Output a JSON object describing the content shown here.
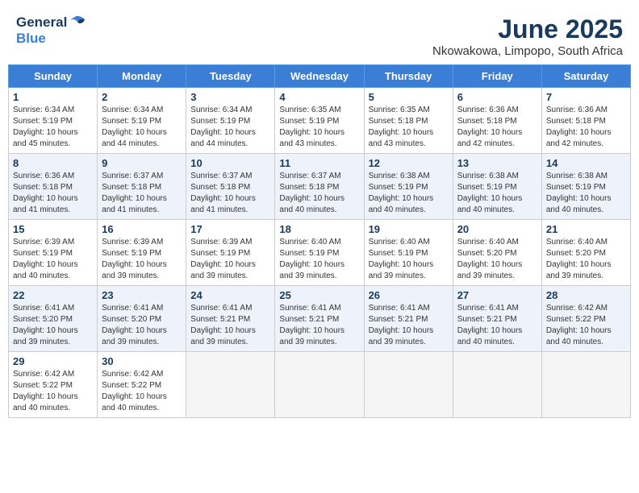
{
  "header": {
    "logo_general": "General",
    "logo_blue": "Blue",
    "month": "June 2025",
    "location": "Nkowakowa, Limpopo, South Africa"
  },
  "days_of_week": [
    "Sunday",
    "Monday",
    "Tuesday",
    "Wednesday",
    "Thursday",
    "Friday",
    "Saturday"
  ],
  "weeks": [
    [
      {
        "day": "1",
        "sunrise": "6:34 AM",
        "sunset": "5:19 PM",
        "daylight": "10 hours and 45 minutes."
      },
      {
        "day": "2",
        "sunrise": "6:34 AM",
        "sunset": "5:19 PM",
        "daylight": "10 hours and 44 minutes."
      },
      {
        "day": "3",
        "sunrise": "6:34 AM",
        "sunset": "5:19 PM",
        "daylight": "10 hours and 44 minutes."
      },
      {
        "day": "4",
        "sunrise": "6:35 AM",
        "sunset": "5:19 PM",
        "daylight": "10 hours and 43 minutes."
      },
      {
        "day": "5",
        "sunrise": "6:35 AM",
        "sunset": "5:18 PM",
        "daylight": "10 hours and 43 minutes."
      },
      {
        "day": "6",
        "sunrise": "6:36 AM",
        "sunset": "5:18 PM",
        "daylight": "10 hours and 42 minutes."
      },
      {
        "day": "7",
        "sunrise": "6:36 AM",
        "sunset": "5:18 PM",
        "daylight": "10 hours and 42 minutes."
      }
    ],
    [
      {
        "day": "8",
        "sunrise": "6:36 AM",
        "sunset": "5:18 PM",
        "daylight": "10 hours and 41 minutes."
      },
      {
        "day": "9",
        "sunrise": "6:37 AM",
        "sunset": "5:18 PM",
        "daylight": "10 hours and 41 minutes."
      },
      {
        "day": "10",
        "sunrise": "6:37 AM",
        "sunset": "5:18 PM",
        "daylight": "10 hours and 41 minutes."
      },
      {
        "day": "11",
        "sunrise": "6:37 AM",
        "sunset": "5:18 PM",
        "daylight": "10 hours and 40 minutes."
      },
      {
        "day": "12",
        "sunrise": "6:38 AM",
        "sunset": "5:19 PM",
        "daylight": "10 hours and 40 minutes."
      },
      {
        "day": "13",
        "sunrise": "6:38 AM",
        "sunset": "5:19 PM",
        "daylight": "10 hours and 40 minutes."
      },
      {
        "day": "14",
        "sunrise": "6:38 AM",
        "sunset": "5:19 PM",
        "daylight": "10 hours and 40 minutes."
      }
    ],
    [
      {
        "day": "15",
        "sunrise": "6:39 AM",
        "sunset": "5:19 PM",
        "daylight": "10 hours and 40 minutes."
      },
      {
        "day": "16",
        "sunrise": "6:39 AM",
        "sunset": "5:19 PM",
        "daylight": "10 hours and 39 minutes."
      },
      {
        "day": "17",
        "sunrise": "6:39 AM",
        "sunset": "5:19 PM",
        "daylight": "10 hours and 39 minutes."
      },
      {
        "day": "18",
        "sunrise": "6:40 AM",
        "sunset": "5:19 PM",
        "daylight": "10 hours and 39 minutes."
      },
      {
        "day": "19",
        "sunrise": "6:40 AM",
        "sunset": "5:19 PM",
        "daylight": "10 hours and 39 minutes."
      },
      {
        "day": "20",
        "sunrise": "6:40 AM",
        "sunset": "5:20 PM",
        "daylight": "10 hours and 39 minutes."
      },
      {
        "day": "21",
        "sunrise": "6:40 AM",
        "sunset": "5:20 PM",
        "daylight": "10 hours and 39 minutes."
      }
    ],
    [
      {
        "day": "22",
        "sunrise": "6:41 AM",
        "sunset": "5:20 PM",
        "daylight": "10 hours and 39 minutes."
      },
      {
        "day": "23",
        "sunrise": "6:41 AM",
        "sunset": "5:20 PM",
        "daylight": "10 hours and 39 minutes."
      },
      {
        "day": "24",
        "sunrise": "6:41 AM",
        "sunset": "5:21 PM",
        "daylight": "10 hours and 39 minutes."
      },
      {
        "day": "25",
        "sunrise": "6:41 AM",
        "sunset": "5:21 PM",
        "daylight": "10 hours and 39 minutes."
      },
      {
        "day": "26",
        "sunrise": "6:41 AM",
        "sunset": "5:21 PM",
        "daylight": "10 hours and 39 minutes."
      },
      {
        "day": "27",
        "sunrise": "6:41 AM",
        "sunset": "5:21 PM",
        "daylight": "10 hours and 40 minutes."
      },
      {
        "day": "28",
        "sunrise": "6:42 AM",
        "sunset": "5:22 PM",
        "daylight": "10 hours and 40 minutes."
      }
    ],
    [
      {
        "day": "29",
        "sunrise": "6:42 AM",
        "sunset": "5:22 PM",
        "daylight": "10 hours and 40 minutes."
      },
      {
        "day": "30",
        "sunrise": "6:42 AM",
        "sunset": "5:22 PM",
        "daylight": "10 hours and 40 minutes."
      },
      null,
      null,
      null,
      null,
      null
    ]
  ],
  "labels": {
    "sunrise_prefix": "Sunrise: ",
    "sunset_prefix": "Sunset: ",
    "daylight_prefix": "Daylight: "
  }
}
